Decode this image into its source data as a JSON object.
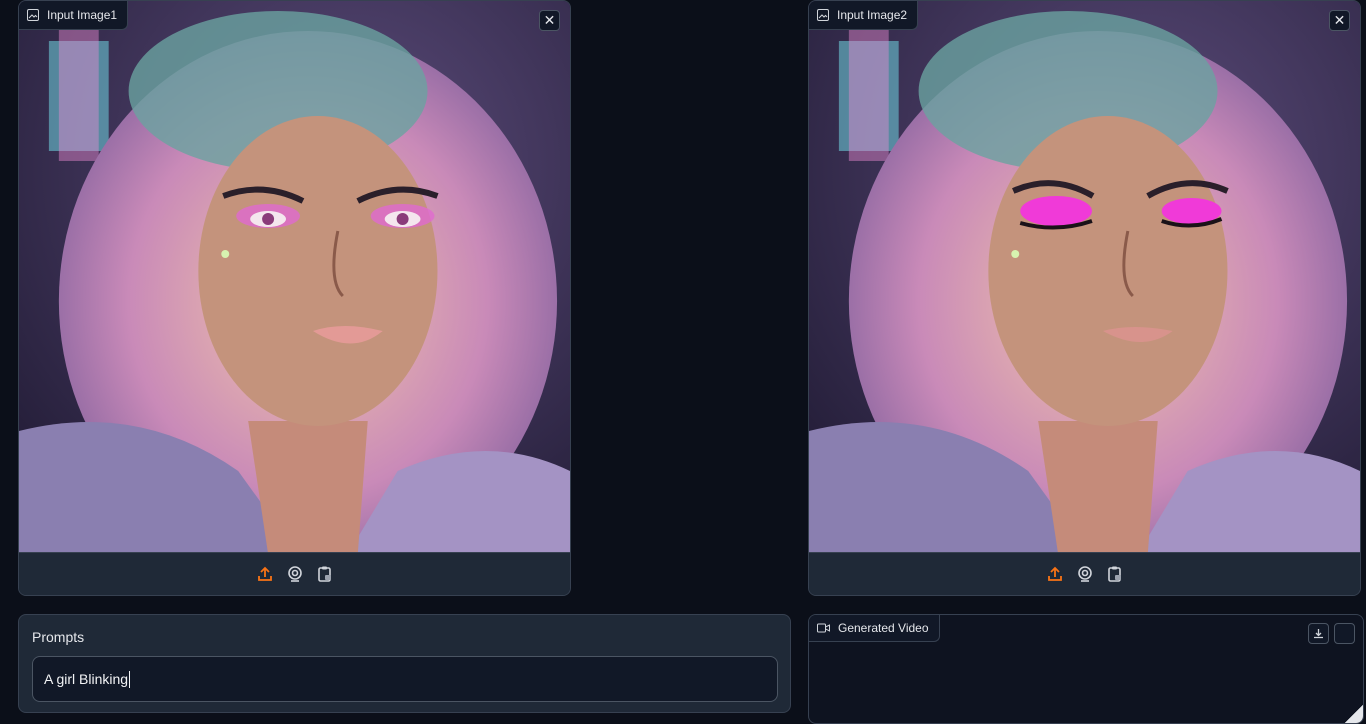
{
  "input_image_1": {
    "label": "Input Image1",
    "close_symbol": "✕",
    "eyes": "open",
    "icons": [
      "image-icon",
      "close-icon",
      "upload-icon",
      "webcam-icon",
      "clipboard-icon"
    ]
  },
  "input_image_2": {
    "label": "Input Image2",
    "close_symbol": "✕",
    "eyes": "closed",
    "icons": [
      "image-icon",
      "close-icon",
      "upload-icon",
      "webcam-icon",
      "clipboard-icon"
    ]
  },
  "prompts": {
    "label": "Prompts",
    "value": "A girl Blinking"
  },
  "generated_video": {
    "label": "Generated Video",
    "icons": [
      "video-icon",
      "download-icon",
      "fullscreen-icon"
    ]
  },
  "colors": {
    "background": "#0b0f19",
    "panel": "#1f2937",
    "border": "#374151",
    "accent": "#f97316",
    "eyeshadow": "#e040c8"
  }
}
